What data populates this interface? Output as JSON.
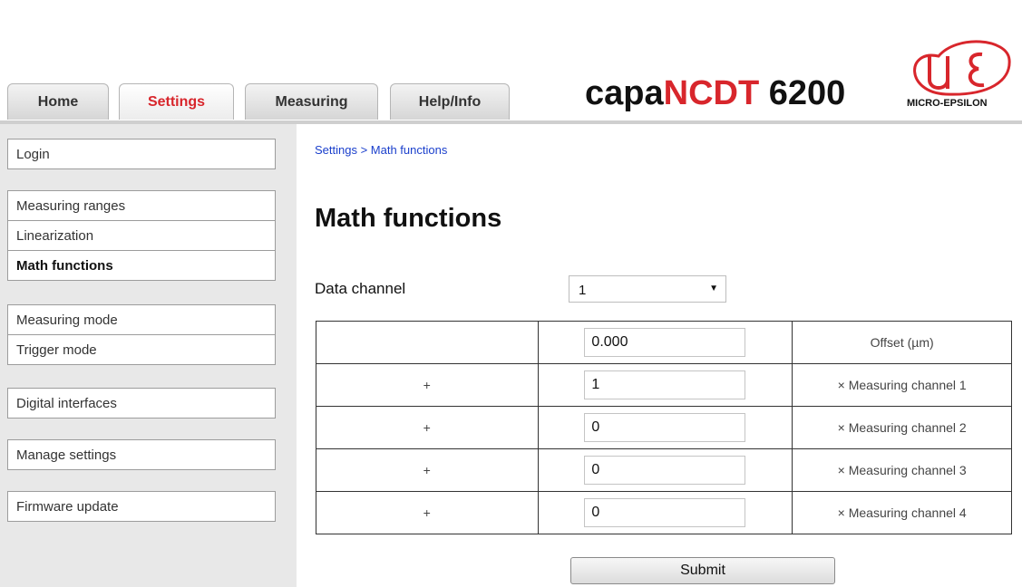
{
  "tabs": [
    {
      "label": "Home",
      "active": false
    },
    {
      "label": "Settings",
      "active": true
    },
    {
      "label": "Measuring",
      "active": false
    },
    {
      "label": "Help/Info",
      "active": false
    }
  ],
  "brand": {
    "prefix": "capa",
    "highlight": "NCDT",
    "suffix": " 6200",
    "logo_text": "MICRO-EPSILON",
    "accent": "#d8262c"
  },
  "sidebar": {
    "groups": [
      [
        "Login"
      ],
      [
        "Measuring ranges",
        "Linearization",
        "Math functions"
      ],
      [
        "Measuring mode",
        "Trigger mode"
      ],
      [
        "Digital interfaces"
      ],
      [
        "Manage settings"
      ],
      [
        "Firmware update"
      ]
    ],
    "active": "Math functions"
  },
  "main": {
    "breadcrumb": "Settings > Math functions",
    "title": "Math functions",
    "data_channel_label": "Data channel",
    "data_channel_value": "1",
    "rows": [
      {
        "op": "",
        "value": "0.000",
        "label": "Offset (µm)"
      },
      {
        "op": "+",
        "value": "1",
        "label": "× Measuring channel 1"
      },
      {
        "op": "+",
        "value": "0",
        "label": "× Measuring channel 2"
      },
      {
        "op": "+",
        "value": "0",
        "label": "× Measuring channel 3"
      },
      {
        "op": "+",
        "value": "0",
        "label": "× Measuring channel 4"
      }
    ],
    "submit_label": "Submit"
  }
}
